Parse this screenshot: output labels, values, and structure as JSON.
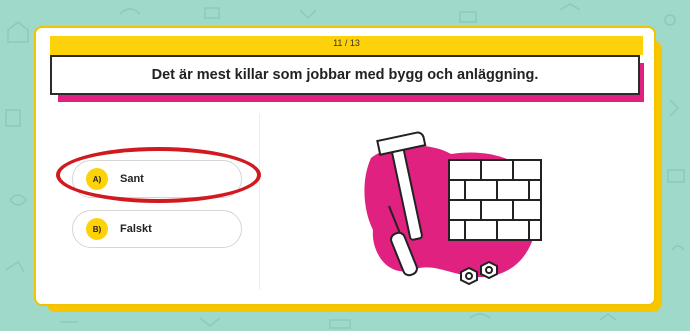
{
  "quiz": {
    "progress": "11 / 13",
    "question": "Det är mest killar som jobbar med bygg och anläggning.",
    "answers": [
      {
        "letter": "A)",
        "label": "Sant",
        "highlighted": true
      },
      {
        "letter": "B)",
        "label": "Falskt",
        "highlighted": false
      }
    ]
  },
  "illustration": {
    "icons": [
      "hammer-icon",
      "brick-wall-icon",
      "screwdriver-icon",
      "nuts-icon"
    ]
  },
  "colors": {
    "background": "#9fd9c9",
    "accent_yellow": "#fed20a",
    "accent_pink": "#e0217f",
    "highlight_red": "#d11a20"
  }
}
